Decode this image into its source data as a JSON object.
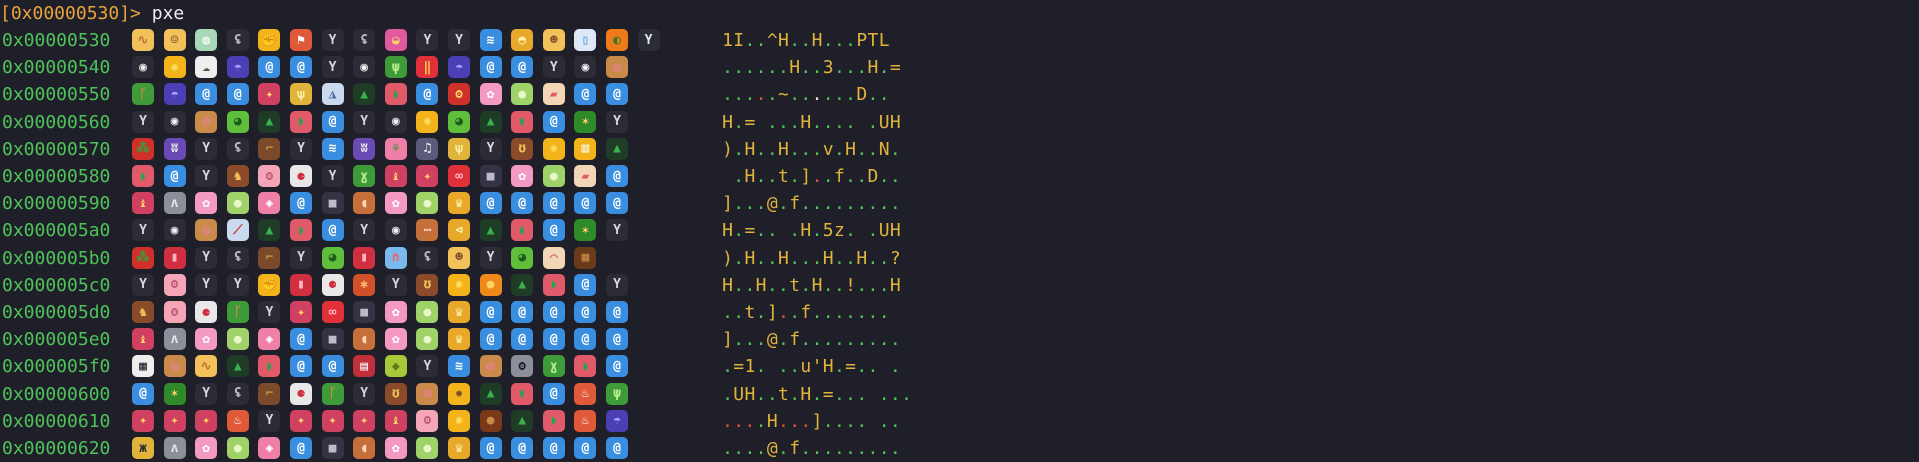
{
  "prompt": "[0x00000530]>",
  "command": "pxe",
  "emoji_glyphs": {
    "spiral": {
      "bg": "#3a8ee0",
      "fg": "#ffffff",
      "ch": "@"
    },
    "fork": {
      "bg": "#2b2c36",
      "fg": "#d8d8d8",
      "ch": "Y"
    },
    "watermelon": {
      "bg": "#e05a6a",
      "fg": "#2fa34a",
      "ch": "◗"
    },
    "tree": {
      "bg": "#1f3d26",
      "fg": "#39b14f",
      "ch": "▲"
    },
    "cow": {
      "bg": "#2b2c36",
      "fg": "#f2f2f2",
      "ch": "◉"
    },
    "sun": {
      "bg": "#f2b41a",
      "fg": "#ffe066",
      "ch": "✺"
    },
    "frog": {
      "bg": "#5fbf3a",
      "fg": "#1d5c1a",
      "ch": "◕"
    },
    "donut": {
      "bg": "#c98a4a",
      "fg": "#f07fa8",
      "ch": "◎"
    },
    "blossom": {
      "bg": "#f49ac2",
      "fg": "#ffffff",
      "ch": "✿"
    },
    "melon": {
      "bg": "#9fd36a",
      "fg": "#e8f7c7",
      "ch": "●"
    },
    "trophy": {
      "bg": "#e8a92a",
      "fg": "#fff2b0",
      "ch": "♛"
    },
    "umbrella": {
      "bg": "#4b3fb5",
      "fg": "#a9a1ff",
      "ch": "☂"
    },
    "rat": {
      "bg": "#2b2c36",
      "fg": "#b9b9b9",
      "ch": "ʢ"
    },
    "cactus": {
      "bg": "#3f9a3a",
      "fg": "#b7f08a",
      "ch": "ψ"
    },
    "pizza": {
      "bg": "#f2c15a",
      "fg": "#d84b2b",
      "ch": "◭"
    },
    "cake": {
      "bg": "#f2d6b5",
      "fg": "#e05a6a",
      "ch": "▰"
    },
    "lipstick": {
      "bg": "#d02f3f",
      "fg": "#ffb3bb",
      "ch": "▮"
    },
    "bowling": {
      "bg": "#e8e8e8",
      "fg": "#d02f3f",
      "ch": "⚈"
    },
    "hammock": {
      "bg": "#ef8a2a",
      "fg": "#ffffff",
      "ch": "≈"
    },
    "camera": {
      "bg": "#333344",
      "fg": "#bbbbcc",
      "ch": "■"
    },
    "pig": {
      "bg": "#f4a6b8",
      "fg": "#c45b77",
      "ch": "ʘ"
    },
    "candy": {
      "bg": "#f07fa8",
      "fg": "#ffffff",
      "ch": "◈"
    },
    "meat": {
      "bg": "#c5703a",
      "fg": "#ffd9b5",
      "ch": "◖"
    },
    "rider": {
      "bg": "#8b4a2a",
      "fg": "#f2c15a",
      "ch": "♞"
    },
    "swim": {
      "bg": "#3a8ee0",
      "fg": "#ffffff",
      "ch": "≋"
    },
    "wolf": {
      "bg": "#8a8f9a",
      "fg": "#e6e6e6",
      "ch": "ʌ"
    },
    "dolls": {
      "bg": "#d04060",
      "fg": "#ffd166",
      "ch": "♝"
    },
    "boot": {
      "bg": "#7a4a2a",
      "fg": "#c98a4a",
      "ch": "⌐"
    },
    "pasta": {
      "bg": "#f2c15a",
      "fg": "#c5703a",
      "ch": "∿"
    },
    "boy": {
      "bg": "#f2c15a",
      "fg": "#7a4a2a",
      "ch": "☺"
    },
    "cup": {
      "bg": "#a9d8b8",
      "fg": "#ffffff",
      "ch": "◍"
    },
    "fist": {
      "bg": "#f2b41a",
      "fg": "#c5703a",
      "ch": "✊"
    },
    "flag": {
      "bg": "#e05a3a",
      "fg": "#ffffff",
      "ch": "⚑"
    },
    "purse": {
      "bg": "#e05aa0",
      "fg": "#ffd166",
      "ch": "◒"
    },
    "bun": {
      "bg": "#e8a92a",
      "fg": "#fff2b0",
      "ch": "◓"
    },
    "woman": {
      "bg": "#f2c15a",
      "fg": "#7a4a2a",
      "ch": "☻"
    },
    "bottle": {
      "bg": "#dfe9f5",
      "fg": "#3a8ee0",
      "ch": "▯"
    },
    "pumpkin": {
      "bg": "#ef7a1a",
      "fg": "#2f7a2a",
      "ch": "◐"
    },
    "cocktail": {
      "bg": "#2b2c36",
      "fg": "#dfe9f5",
      "ch": "Y"
    },
    "sheep": {
      "bg": "#eeeeee",
      "fg": "#555555",
      "ch": "☁"
    },
    "fries": {
      "bg": "#e0303a",
      "fg": "#f2d24a",
      "ch": "‖"
    },
    "palm": {
      "bg": "#3f9a3a",
      "fg": "#c98a4a",
      "ch": "ᚴ"
    },
    "sparkler": {
      "bg": "#d04060",
      "fg": "#ffd166",
      "ch": "✦"
    },
    "wheat": {
      "bg": "#e0b43a",
      "fg": "#fff2b0",
      "ch": "ѱ"
    },
    "mountain": {
      "bg": "#c9d9ee",
      "fg": "#4a6a9a",
      "ch": "◮"
    },
    "ogre": {
      "bg": "#d0302a",
      "fg": "#ffd166",
      "ch": "ʘ"
    },
    "xmas": {
      "bg": "#2f8a2a",
      "fg": "#ffd166",
      "ch": "✶"
    },
    "alien": {
      "bg": "#8a8f9a",
      "fg": "#1e1f29",
      "ch": "ʘ"
    },
    "sprout": {
      "bg": "#3f9a3a",
      "fg": "#b7f08a",
      "ch": "ɣ"
    },
    "chestnut": {
      "bg": "#7a3a1a",
      "fg": "#c98a4a",
      "ch": "●"
    },
    "dancers": {
      "bg": "#e0b43a",
      "fg": "#2b2c36",
      "ch": "ж"
    },
    "pear": {
      "bg": "#a8c83a",
      "fg": "#5a7a1a",
      "ch": "◆"
    },
    "orange": {
      "bg": "#ef8a1a",
      "fg": "#ffd166",
      "ch": "●"
    },
    "chocolate": {
      "bg": "#6a3a1a",
      "fg": "#c98a4a",
      "ch": "▦"
    },
    "bikini": {
      "bg": "#e0303a",
      "fg": "#ffb3bb",
      "ch": "∞"
    },
    "leaf": {
      "bg": "#d0502a",
      "fg": "#ffb36a",
      "ch": "✱"
    },
    "rainbow": {
      "bg": "#7ab8ee",
      "fg": "#ff5a5a",
      "ch": "∩"
    },
    "music": {
      "bg": "#5a5a7a",
      "fg": "#ffffff",
      "ch": "♫"
    },
    "beer": {
      "bg": "#f2b41a",
      "fg": "#ffffff",
      "ch": "▥"
    },
    "bull": {
      "bg": "#8b4a2a",
      "fg": "#f2c15a",
      "ch": "ʊ"
    },
    "skier": {
      "bg": "#c9d9ee",
      "fg": "#d0302a",
      "ch": "⟋"
    },
    "tulip": {
      "bg": "#f07fa8",
      "fg": "#3f9a3a",
      "ch": "⚘"
    },
    "monster": {
      "bg": "#6a4ab5",
      "fg": "#e6e6e6",
      "ch": "ʬ"
    },
    "trumpet": {
      "bg": "#e8a92a",
      "fg": "#fff2b0",
      "ch": "⊲"
    },
    "skewer": {
      "bg": "#c5703a",
      "fg": "#f2d6b5",
      "ch": "⋯"
    },
    "brush": {
      "bg": "#f2d6b5",
      "fg": "#e05a6a",
      "ch": "⌒"
    },
    "cherries": {
      "bg": "#d0302a",
      "fg": "#3f9a3a",
      "ch": "⁂"
    },
    "racing": {
      "bg": "#eeeeee",
      "fg": "#1e1f29",
      "ch": "▦"
    },
    "sunflower": {
      "bg": "#f2b41a",
      "fg": "#7a4a2a",
      "ch": "✹"
    },
    "card": {
      "bg": "#c0303a",
      "fg": "#ffffff",
      "ch": "▤"
    },
    "hotspring": {
      "bg": "#e05a3a",
      "fg": "#ffffff",
      "ch": "♨"
    }
  },
  "rows": [
    {
      "addr": "0x00000530",
      "emojis": [
        "pasta",
        "boy",
        "cup",
        "rat",
        "fist",
        "flag",
        "fork",
        "rat",
        "purse",
        "fork",
        "fork",
        "swim",
        "bun",
        "woman",
        "bottle",
        "pumpkin",
        "cocktail"
      ],
      "ascii": [
        "1",
        "I",
        ".",
        ".",
        "^",
        "H",
        ".",
        ".",
        "H",
        ".",
        ".",
        ".",
        "P",
        "T",
        "L"
      ],
      "colors": [
        "y",
        "y",
        "g",
        "g",
        "y",
        "y",
        "g",
        "g",
        "y",
        "g",
        "g",
        "g",
        "y",
        "y",
        "y"
      ]
    },
    {
      "addr": "0x00000540",
      "emojis": [
        "cow",
        "sun",
        "sheep",
        "umbrella",
        "spiral",
        "spiral",
        "fork",
        "cow",
        "cactus",
        "fries",
        "umbrella",
        "spiral",
        "spiral",
        "fork",
        "cow",
        "donut"
      ],
      "ascii": [
        ".",
        ".",
        ".",
        ".",
        ".",
        ".",
        "H",
        ".",
        ".",
        "3",
        ".",
        ".",
        ".",
        "H",
        ".",
        "="
      ],
      "colors": [
        "g",
        "g",
        "g",
        "g",
        "g",
        "g",
        "y",
        "g",
        "g",
        "y",
        "g",
        "g",
        "g",
        "y",
        "g",
        "y"
      ]
    },
    {
      "addr": "0x00000550",
      "emojis": [
        "palm",
        "umbrella",
        "spiral",
        "spiral",
        "sparkler",
        "wheat",
        "mountain",
        "tree",
        "watermelon",
        "spiral",
        "ogre",
        "blossom",
        "melon",
        "cake",
        "spiral",
        "spiral"
      ],
      "ascii": [
        ".",
        ".",
        ".",
        ".",
        ".",
        "~",
        ".",
        ".",
        ".",
        ".",
        ".",
        ".",
        "D",
        ".",
        "."
      ],
      "colors": [
        "g",
        "g",
        "g",
        "r",
        "g",
        "y",
        "g",
        "g",
        "w",
        "g",
        "g",
        "g",
        "y",
        "g",
        "g"
      ]
    },
    {
      "addr": "0x00000560",
      "emojis": [
        "fork",
        "cow",
        "donut",
        "frog",
        "tree",
        "watermelon",
        "spiral",
        "fork",
        "cow",
        "sun",
        "frog",
        "tree",
        "watermelon",
        "spiral",
        "xmas",
        "fork"
      ],
      "ascii": [
        "H",
        ".",
        "=",
        " ",
        ".",
        ".",
        ".",
        "H",
        ".",
        ".",
        ".",
        ".",
        " ",
        ".",
        "U",
        "H"
      ],
      "colors": [
        "y",
        "g",
        "y",
        "g",
        "g",
        "g",
        "g",
        "y",
        "g",
        "g",
        "g",
        "g",
        "g",
        "g",
        "y",
        "y"
      ]
    },
    {
      "addr": "0x00000570",
      "emojis": [
        "cherries",
        "monster",
        "fork",
        "rat",
        "boot",
        "fork",
        "swim",
        "monster",
        "tulip",
        "music",
        "wheat",
        "fork",
        "bull",
        "sun",
        "beer",
        "tree"
      ],
      "ascii": [
        ")",
        ".",
        "H",
        ".",
        ".",
        "H",
        ".",
        ".",
        ".",
        "v",
        ".",
        "H",
        ".",
        ".",
        "N",
        "."
      ],
      "colors": [
        "y",
        "g",
        "y",
        "g",
        "g",
        "y",
        "g",
        "g",
        "g",
        "y",
        "g",
        "y",
        "g",
        "g",
        "y",
        "g"
      ]
    },
    {
      "addr": "0x00000580",
      "emojis": [
        "watermelon",
        "spiral",
        "fork",
        "rider",
        "pig",
        "bowling",
        "fork",
        "sprout",
        "dolls",
        "sparkler",
        "bikini",
        "camera",
        "blossom",
        "melon",
        "cake",
        "spiral"
      ],
      "ascii": [
        " ",
        ".",
        "H",
        ".",
        ".",
        "t",
        ".",
        "]",
        ".",
        ".",
        "f",
        ".",
        ".",
        "D",
        ".",
        "."
      ],
      "colors": [
        "g",
        "g",
        "y",
        "g",
        "g",
        "y",
        "g",
        "y",
        "r",
        "g",
        "y",
        "g",
        "g",
        "y",
        "g",
        "g"
      ]
    },
    {
      "addr": "0x00000590",
      "emojis": [
        "dolls",
        "wolf",
        "blossom",
        "melon",
        "candy",
        "spiral",
        "camera",
        "meat",
        "blossom",
        "melon",
        "trophy",
        "spiral",
        "spiral",
        "spiral",
        "spiral",
        "spiral"
      ],
      "ascii": [
        "]",
        ".",
        ".",
        ".",
        "@",
        ".",
        "f",
        ".",
        ".",
        ".",
        ".",
        ".",
        ".",
        ".",
        ".",
        "."
      ],
      "colors": [
        "y",
        "g",
        "g",
        "g",
        "y",
        "g",
        "y",
        "g",
        "g",
        "g",
        "g",
        "g",
        "g",
        "g",
        "g",
        "g"
      ]
    },
    {
      "addr": "0x000005a0",
      "emojis": [
        "fork",
        "cow",
        "donut",
        "skier",
        "tree",
        "watermelon",
        "spiral",
        "fork",
        "cow",
        "skewer",
        "trumpet",
        "tree",
        "watermelon",
        "spiral",
        "xmas",
        "fork"
      ],
      "ascii": [
        "H",
        ".",
        "=",
        ".",
        ".",
        " ",
        ".",
        "H",
        ".",
        "5",
        "z",
        ".",
        " ",
        ".",
        "U",
        "H"
      ],
      "colors": [
        "y",
        "g",
        "y",
        "g",
        "g",
        "g",
        "g",
        "y",
        "g",
        "y",
        "y",
        "g",
        "g",
        "g",
        "y",
        "y"
      ]
    },
    {
      "addr": "0x000005b0",
      "emojis": [
        "cherries",
        "lipstick",
        "fork",
        "rat",
        "boot",
        "fork",
        "frog",
        "lipstick",
        "rainbow",
        "rat",
        "woman",
        "fork",
        "frog",
        "brush",
        "chocolate"
      ],
      "ascii": [
        ")",
        ".",
        "H",
        ".",
        ".",
        "H",
        ".",
        ".",
        ".",
        "H",
        ".",
        ".",
        "H",
        ".",
        ".",
        "?"
      ],
      "colors": [
        "y",
        "g",
        "y",
        "g",
        "g",
        "y",
        "g",
        "g",
        "g",
        "y",
        "g",
        "g",
        "y",
        "g",
        "g",
        "y"
      ]
    },
    {
      "addr": "0x000005c0",
      "emojis": [
        "fork",
        "pig",
        "fork",
        "fork",
        "fist",
        "lipstick",
        "bowling",
        "leaf",
        "fork",
        "bull",
        "sun",
        "orange",
        "tree",
        "watermelon",
        "spiral",
        "fork"
      ],
      "ascii": [
        "H",
        ".",
        ".",
        "H",
        ".",
        ".",
        "t",
        ".",
        "H",
        ".",
        ".",
        "!",
        ".",
        ".",
        ".",
        "H"
      ],
      "colors": [
        "y",
        "g",
        "g",
        "y",
        "g",
        "g",
        "y",
        "g",
        "y",
        "g",
        "g",
        "y",
        "g",
        " ",
        "g",
        "y"
      ]
    },
    {
      "addr": "0x000005d0",
      "emojis": [
        "rider",
        "pig",
        "bowling",
        "palm",
        "fork",
        "sparkler",
        "bikini",
        "camera",
        "blossom",
        "melon",
        "trophy",
        "spiral",
        "spiral",
        "spiral",
        "spiral",
        "spiral"
      ],
      "ascii": [
        ".",
        ".",
        "t",
        ".",
        "]",
        ".",
        ".",
        "f",
        ".",
        ".",
        ".",
        ".",
        ".",
        ".",
        "."
      ],
      "colors": [
        "g",
        "g",
        "y",
        "g",
        "y",
        "r",
        "g",
        "y",
        "g",
        "g",
        "g",
        "g",
        "g",
        "g",
        "g"
      ]
    },
    {
      "addr": "0x000005e0",
      "emojis": [
        "dolls",
        "wolf",
        "blossom",
        "melon",
        "candy",
        "spiral",
        "camera",
        "meat",
        "blossom",
        "melon",
        "trophy",
        "spiral",
        "spiral",
        "spiral",
        "spiral",
        "spiral"
      ],
      "ascii": [
        "]",
        ".",
        ".",
        ".",
        "@",
        ".",
        "f",
        ".",
        ".",
        ".",
        ".",
        ".",
        ".",
        ".",
        ".",
        "."
      ],
      "colors": [
        "y",
        "g",
        "g",
        "g",
        "y",
        "g",
        "y",
        "g",
        "g",
        "g",
        "g",
        "g",
        "g",
        "g",
        "g",
        "g"
      ]
    },
    {
      "addr": "0x000005f0",
      "emojis": [
        "racing",
        "donut",
        "pasta",
        "tree",
        "watermelon",
        "spiral",
        "spiral",
        "card",
        "pear",
        "fork",
        "swim",
        "donut",
        "alien",
        "sprout",
        "watermelon",
        "spiral"
      ],
      "ascii": [
        ".",
        "=",
        "1",
        ".",
        " ",
        ".",
        ".",
        "u",
        "'",
        "H",
        ".",
        "=",
        ".",
        ".",
        " ",
        "."
      ],
      "colors": [
        "g",
        "y",
        "y",
        "g",
        "g",
        "g",
        "g",
        "y",
        "y",
        "y",
        "g",
        "y",
        "g",
        "g",
        "g",
        "g"
      ]
    },
    {
      "addr": "0x00000600",
      "emojis": [
        "spiral",
        "xmas",
        "fork",
        "rat",
        "boot",
        "bowling",
        "palm",
        "fork",
        "bull",
        "donut",
        "sunflower",
        "tree",
        "watermelon",
        "spiral",
        "hotspring",
        "cactus"
      ],
      "ascii": [
        ".",
        "U",
        "H",
        ".",
        ".",
        "t",
        ".",
        "H",
        ".",
        "=",
        ".",
        ".",
        ".",
        " ",
        ".",
        ".",
        "."
      ],
      "colors": [
        "g",
        "y",
        "y",
        "g",
        "g",
        "y",
        "g",
        "y",
        "g",
        "y",
        "g",
        "g",
        "g",
        "g",
        "g",
        "g",
        "g"
      ]
    },
    {
      "addr": "0x00000610",
      "emojis": [
        "sparkler",
        "sparkler",
        "sparkler",
        "hotspring",
        "fork",
        "sparkler",
        "sparkler",
        "sparkler",
        "dolls",
        "pig",
        "sun",
        "chestnut",
        "tree",
        "watermelon",
        "hotspring",
        "umbrella"
      ],
      "ascii": [
        ".",
        ".",
        ".",
        ".",
        "H",
        ".",
        ".",
        ".",
        "]",
        ".",
        ".",
        ".",
        ".",
        " ",
        ".",
        "."
      ],
      "colors": [
        "r",
        "r",
        "r",
        "g",
        "y",
        "r",
        "r",
        "r",
        "y",
        "g",
        "g",
        "g",
        "g",
        "g",
        "g",
        "g"
      ]
    },
    {
      "addr": "0x00000620",
      "emojis": [
        "dancers",
        "wolf",
        "blossom",
        "melon",
        "candy",
        "spiral",
        "camera",
        "meat",
        "blossom",
        "melon",
        "trophy",
        "spiral",
        "spiral",
        "spiral",
        "spiral",
        "spiral"
      ],
      "ascii": [
        ".",
        ".",
        ".",
        ".",
        "@",
        ".",
        "f",
        ".",
        ".",
        ".",
        ".",
        ".",
        ".",
        ".",
        ".",
        "."
      ],
      "colors": [
        "g",
        "g",
        "g",
        "g",
        "y",
        "g",
        "y",
        "g",
        "g",
        "g",
        "g",
        "g",
        "g",
        "g",
        "g",
        "g"
      ]
    }
  ]
}
